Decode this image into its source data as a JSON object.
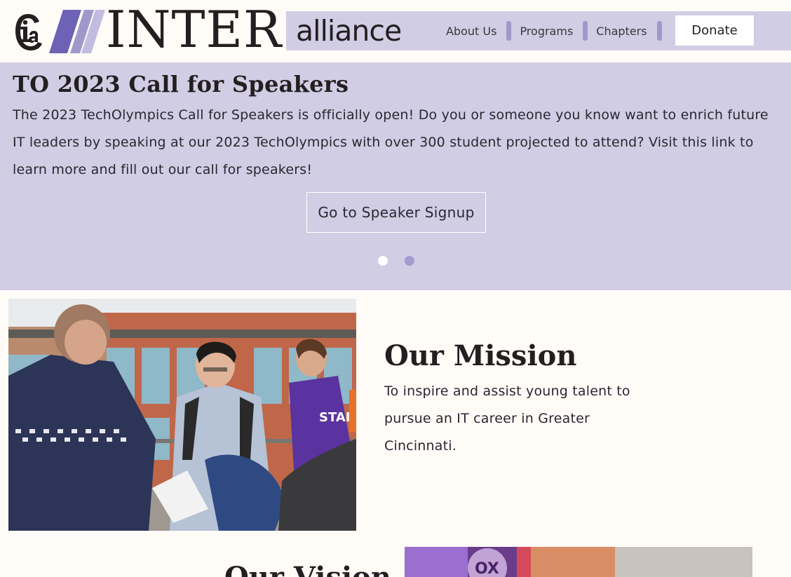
{
  "header": {
    "logo_inter": "INTER",
    "logo_alliance": "alliance",
    "logo_mark_text": "ia",
    "nav": [
      {
        "label": "About Us"
      },
      {
        "label": "Programs"
      },
      {
        "label": "Chapters"
      }
    ],
    "donate_label": "Donate",
    "colors": {
      "band": "#d1cde4",
      "accent": "#9f99cb",
      "stripe_dark": "#6d62b6"
    }
  },
  "hero": {
    "title": "TO 2023 Call for Speakers",
    "text": "The 2023 TechOlympics Call for Speakers is officially open! Do you or someone you know want to enrich future IT leaders by speaking at our 2023 TechOlympics with over 300 student projected to attend? Visit this link to learn more and fill out our call for speakers!",
    "button_label": "Go to Speaker Signup",
    "slides": 2,
    "active_slide": 1
  },
  "mission": {
    "title": "Our Mission",
    "text": "To inspire and assist young talent to pursue an IT career in Greater Cincinnati.",
    "photo_icon": "photo-students-networking"
  },
  "vision": {
    "title": "Our Vision",
    "photo_icon": "photo-event"
  }
}
